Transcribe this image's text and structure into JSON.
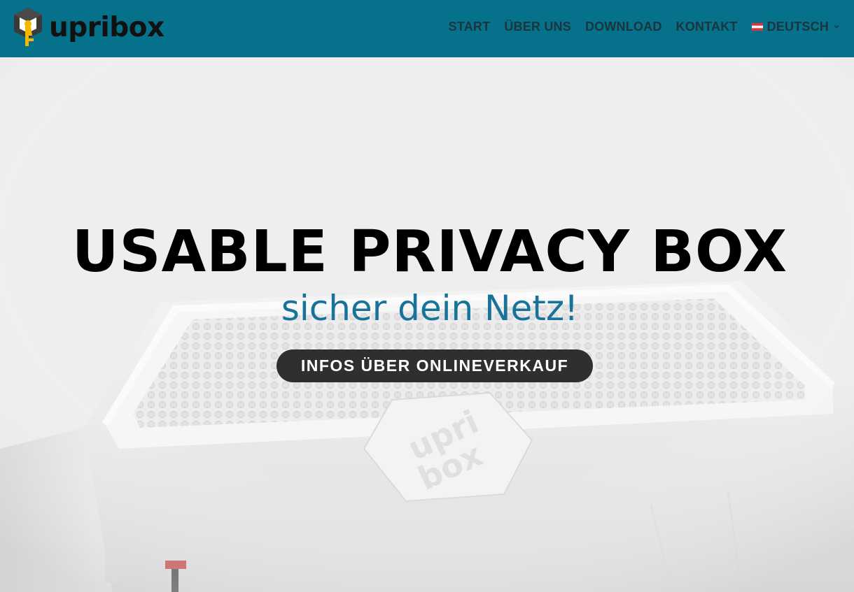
{
  "header": {
    "logo_text": "upribox",
    "logo_icon": "upribox-logo-icon",
    "background_color": "#06718a",
    "nav": [
      {
        "label": "START",
        "name": "nav-start"
      },
      {
        "label": "ÜBER UNS",
        "name": "nav-uber-uns"
      },
      {
        "label": "DOWNLOAD",
        "name": "nav-download"
      },
      {
        "label": "KONTAKT",
        "name": "nav-kontakt"
      }
    ],
    "language": {
      "label": "DEUTSCH",
      "flag_icon": "austria-flag-icon",
      "dropdown_icon": "chevron-down-icon"
    }
  },
  "hero": {
    "title": "USABLE PRIVACY BOX",
    "subtitle": "sicher dein Netz!",
    "cta_label": "INFOS ÜBER ONLINEVERKAUF",
    "subtitle_color": "#18739a",
    "cta_color": "#2f2f2f",
    "image_icon": "upribox-device-photo"
  }
}
